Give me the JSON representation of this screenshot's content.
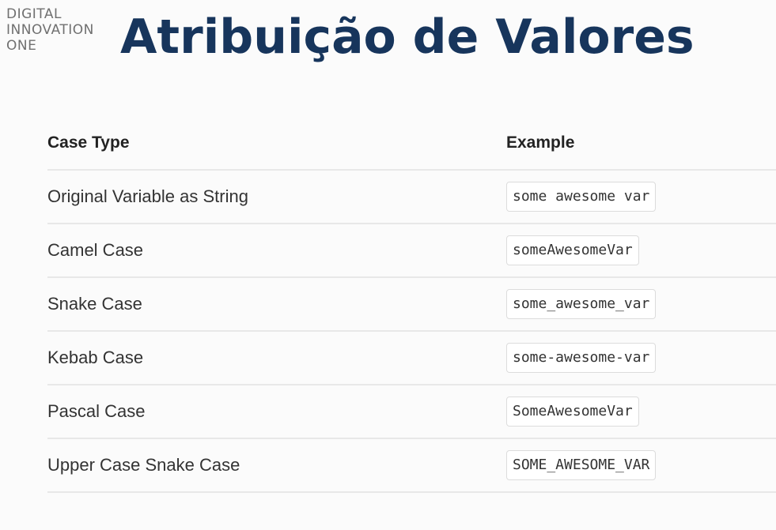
{
  "logo": {
    "line1": "DIGITAL",
    "line2": "INNOVATION",
    "line3": "ONE"
  },
  "title": "Atribuição de Valores",
  "table": {
    "headers": {
      "case_type": "Case Type",
      "example": "Example"
    },
    "rows": [
      {
        "case_type": "Original Variable as String",
        "example": "some awesome var"
      },
      {
        "case_type": "Camel Case",
        "example": "someAwesomeVar"
      },
      {
        "case_type": "Snake Case",
        "example": "some_awesome_var"
      },
      {
        "case_type": "Kebab Case",
        "example": "some-awesome-var"
      },
      {
        "case_type": "Pascal Case",
        "example": "SomeAwesomeVar"
      },
      {
        "case_type": "Upper Case Snake Case",
        "example": "SOME_AWESOME_VAR"
      }
    ]
  },
  "colors": {
    "title": "#17355c",
    "logo": "#707070",
    "divider": "#e8e8e8"
  }
}
